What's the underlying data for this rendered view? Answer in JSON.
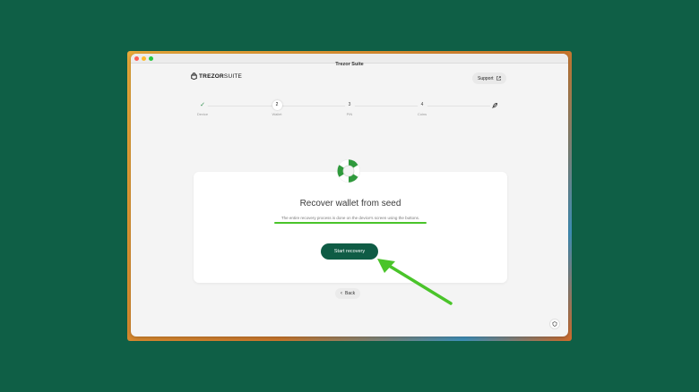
{
  "window": {
    "title": "Trezor Suite"
  },
  "header": {
    "logo_bold": "TREZOR",
    "logo_light": "SUITE",
    "support_label": "Support"
  },
  "stepper": {
    "steps": [
      {
        "num": "✓",
        "label": "Device",
        "state": "done"
      },
      {
        "num": "2",
        "label": "Wallet",
        "state": "active"
      },
      {
        "num": "3",
        "label": "PIN",
        "state": "todo"
      },
      {
        "num": "4",
        "label": "Coins",
        "state": "todo"
      },
      {
        "num": "",
        "label": "",
        "state": "final"
      }
    ]
  },
  "card": {
    "title": "Recover wallet from seed",
    "description": "The entire recovery process is done on the device's screen using the buttons.",
    "start_label": "Start recovery"
  },
  "footer": {
    "back_label": "Back"
  },
  "colors": {
    "accent": "#0f5c45",
    "highlight": "#4ac42a",
    "background": "#0f5f46"
  }
}
